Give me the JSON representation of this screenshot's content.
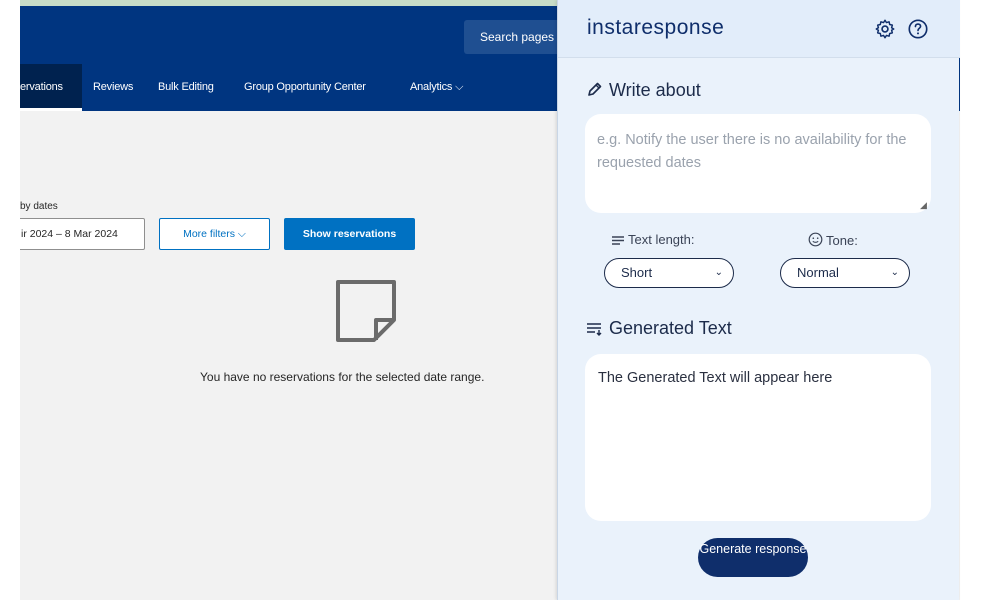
{
  "site": {
    "search_text": "Search pages a",
    "nav": [
      {
        "label": "ervations"
      },
      {
        "label": "Reviews"
      },
      {
        "label": "Bulk Editing"
      },
      {
        "label": "Group Opportunity Center"
      },
      {
        "label": "Analytics ⌵"
      }
    ],
    "filter_label": "by dates",
    "date_range": "ir 2024 – 8 Mar 2024",
    "more_filters": "More filters ⌵",
    "show_button": "Show reservations",
    "empty_message": "You have no reservations for the selected date range."
  },
  "extension": {
    "brand": "instaresponse",
    "write_about_title": "Write about",
    "write_placeholder": "e.g. Notify the user there is no availability for the requested dates",
    "text_length_label": "Text length:",
    "text_length_value": "Short",
    "tone_label": "Tone:",
    "tone_value": "Normal",
    "generated_title": "Generated Text",
    "generated_placeholder": "The Generated Text will appear here",
    "generate_button": "Generate response"
  },
  "colors": {
    "booking_blue": "#003580",
    "accent_blue": "#0071c2",
    "panel_bg": "#eaf2fb",
    "brand_navy": "#0f2e6b"
  }
}
